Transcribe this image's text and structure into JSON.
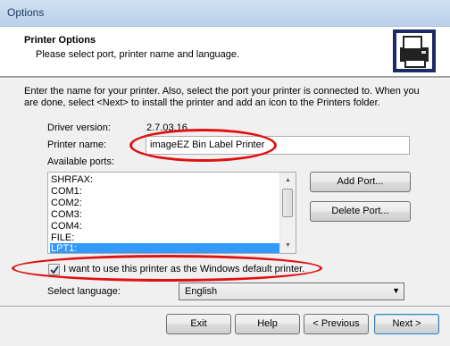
{
  "window": {
    "title": "Options"
  },
  "header": {
    "title": "Printer Options",
    "subtitle": "Please select port, printer name and language."
  },
  "intro": "Enter the name for your printer. Also, select the port your printer is connected to. When you are done, select <Next> to install the printer and add an icon to the Printers folder.",
  "driver": {
    "label": "Driver version:",
    "value": "2.7.03.16"
  },
  "printer_name": {
    "label": "Printer name:",
    "value": "imageEZ Bin Label Printer"
  },
  "ports": {
    "label": "Available ports:",
    "items": [
      "SHRFAX:",
      "COM1:",
      "COM2:",
      "COM3:",
      "COM4:",
      "FILE:",
      "LPT1:"
    ],
    "selected": "LPT1:"
  },
  "buttons": {
    "add_port": "Add Port...",
    "delete_port": "Delete Port...",
    "exit": "Exit",
    "help": "Help",
    "previous": "< Previous",
    "next": "Next >"
  },
  "default_printer": {
    "label": "I want to use this printer as the Windows default printer.",
    "checked": true
  },
  "language": {
    "label": "Select language:",
    "value": "English"
  },
  "colors": {
    "highlight": "#3399ff",
    "annotation": "#e01010"
  }
}
